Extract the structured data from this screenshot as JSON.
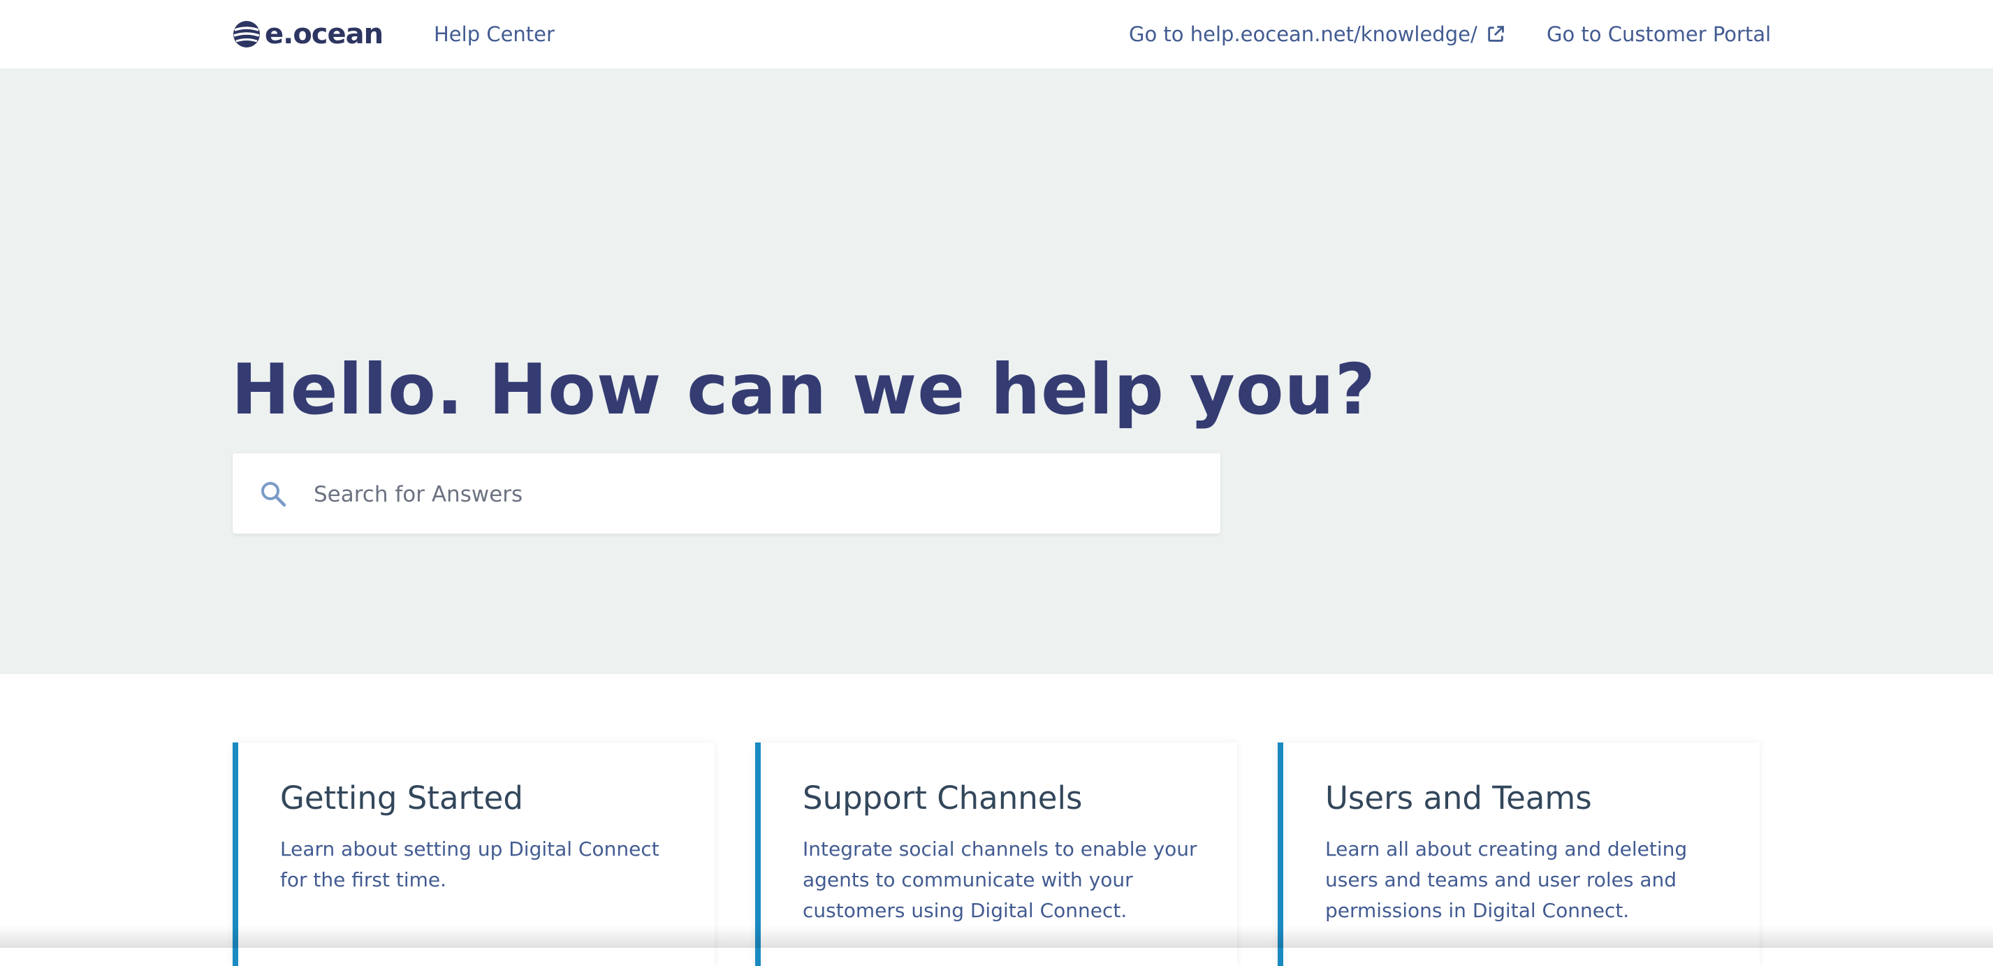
{
  "header": {
    "logo_text": "e.ocean",
    "help_center_label": "Help Center",
    "knowledge_link_label": "Go to help.eocean.net/knowledge/",
    "customer_portal_label": "Go to Customer Portal"
  },
  "hero": {
    "title": "Hello. How can we help you?",
    "search_placeholder": "Search for Answers",
    "search_value": ""
  },
  "cards": [
    {
      "title": "Getting Started",
      "description": "Learn about setting up Digital Connect for the first time."
    },
    {
      "title": "Support Channels",
      "description": "Integrate social channels to enable your agents to communicate with your customers using Digital Connect."
    },
    {
      "title": "Users and Teams",
      "description": "Learn all about creating and deleting users and teams and user roles and permissions in Digital Connect."
    }
  ],
  "colors": {
    "brand_navy": "#343c72",
    "link_blue": "#425b91",
    "accent_blue": "#1a8ac1",
    "hero_background": "#edf1f0"
  },
  "icons": {
    "logo": "eocean-logo-icon",
    "external_link": "external-link-icon",
    "search": "search-icon"
  }
}
